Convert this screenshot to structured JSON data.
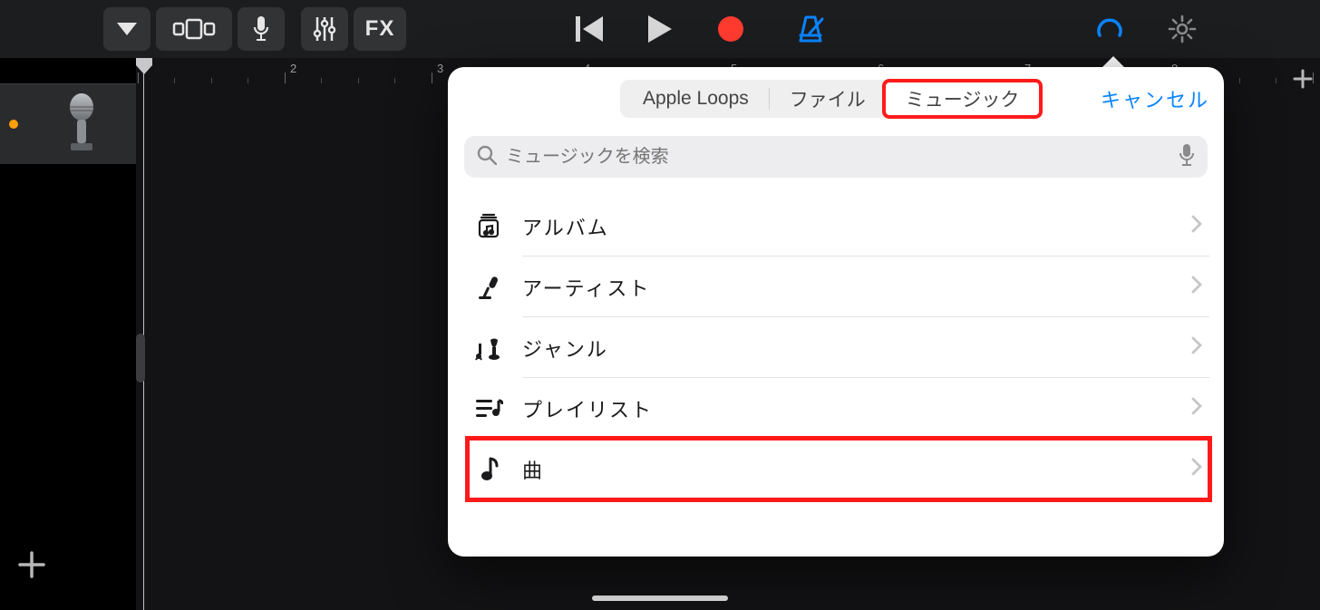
{
  "toolbar": {
    "fx_label": "FX"
  },
  "ruler": {
    "marks": [
      "2",
      "3",
      "4",
      "5",
      "6",
      "7",
      "8"
    ]
  },
  "popover": {
    "segments": {
      "apple_loops": "Apple Loops",
      "file": "ファイル",
      "music": "ミュージック"
    },
    "cancel": "キャンセル",
    "search_placeholder": "ミュージックを検索",
    "rows": {
      "album": "アルバム",
      "artist": "アーティスト",
      "genre": "ジャンル",
      "playlist": "プレイリスト",
      "song": "曲"
    }
  }
}
